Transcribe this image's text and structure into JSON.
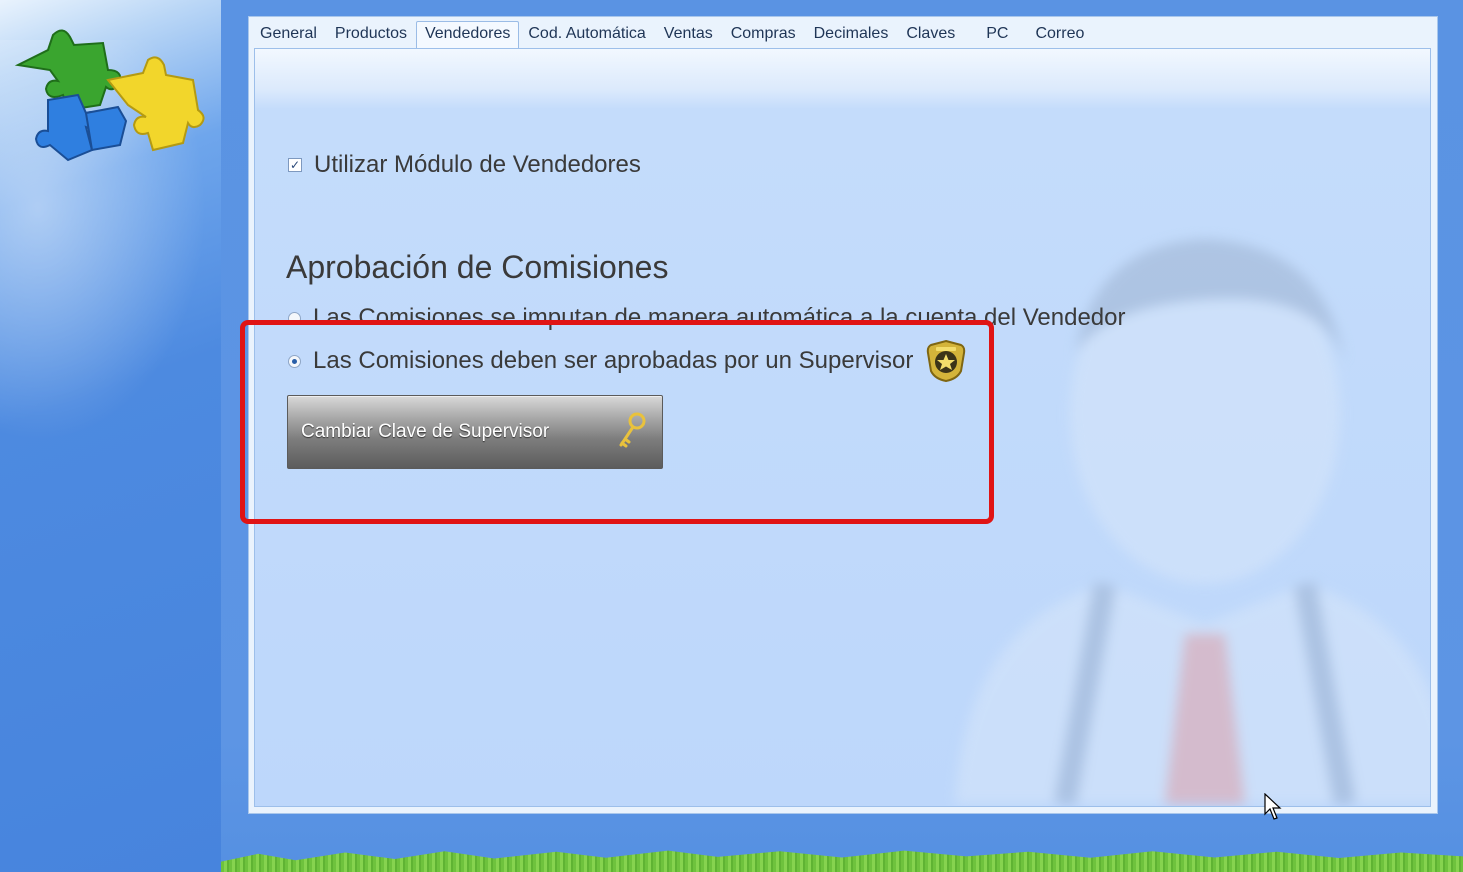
{
  "tabs": [
    {
      "label": "General"
    },
    {
      "label": "Productos"
    },
    {
      "label": "Vendedores",
      "active": true
    },
    {
      "label": "Cod. Automática"
    },
    {
      "label": "Ventas"
    },
    {
      "label": "Compras"
    },
    {
      "label": "Decimales"
    },
    {
      "label": "Claves"
    },
    {
      "label": "PC"
    },
    {
      "label": "Correo"
    }
  ],
  "vendedores": {
    "use_module_label": "Utilizar Módulo de Vendedores",
    "use_module_checked": true,
    "section_title": "Aprobación de Comisiones",
    "radio_automatic_label": "Las Comisiones se imputan de manera automática a la cuenta del Vendedor",
    "radio_supervisor_label": "Las Comisiones deben ser aprobadas por un Supervisor",
    "selected_option": "supervisor",
    "change_password_button": "Cambiar Clave de Supervisor"
  },
  "icons": {
    "logo": "puzzle-logo-icon",
    "badge": "security-badge-icon",
    "key": "key-icon",
    "cursor": "mouse-cursor-icon"
  },
  "colors": {
    "highlight": "#e01414",
    "background": "#5a93e3"
  }
}
